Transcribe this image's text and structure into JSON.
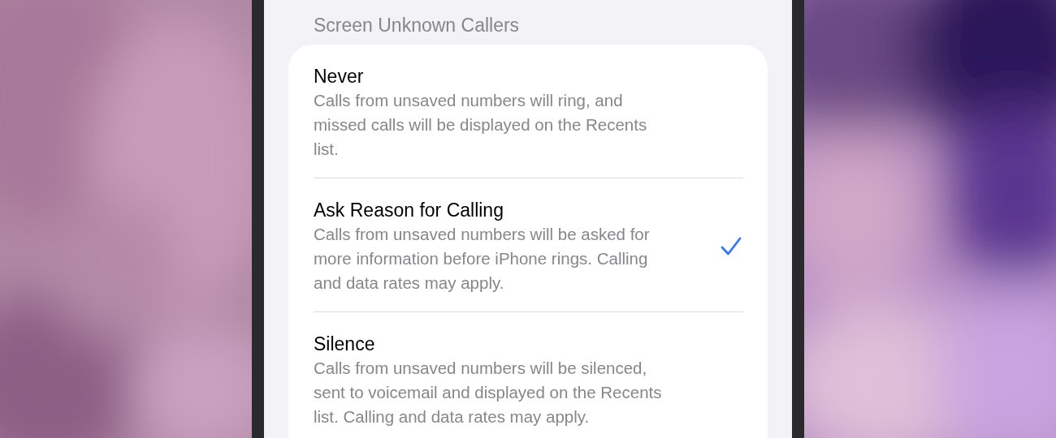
{
  "section_header": "Screen Unknown Callers",
  "options": [
    {
      "title": "Never",
      "description": "Calls from unsaved numbers will ring, and missed calls will be displayed on the Recents list.",
      "selected": false
    },
    {
      "title": "Ask Reason for Calling",
      "description": "Calls from unsaved numbers will be asked for more information before iPhone rings. Calling and data rates may apply.",
      "selected": true
    },
    {
      "title": "Silence",
      "description": "Calls from unsaved numbers will be silenced, sent to voicemail and displayed on the Recents list. Calling and data rates may apply.",
      "selected": false
    }
  ]
}
